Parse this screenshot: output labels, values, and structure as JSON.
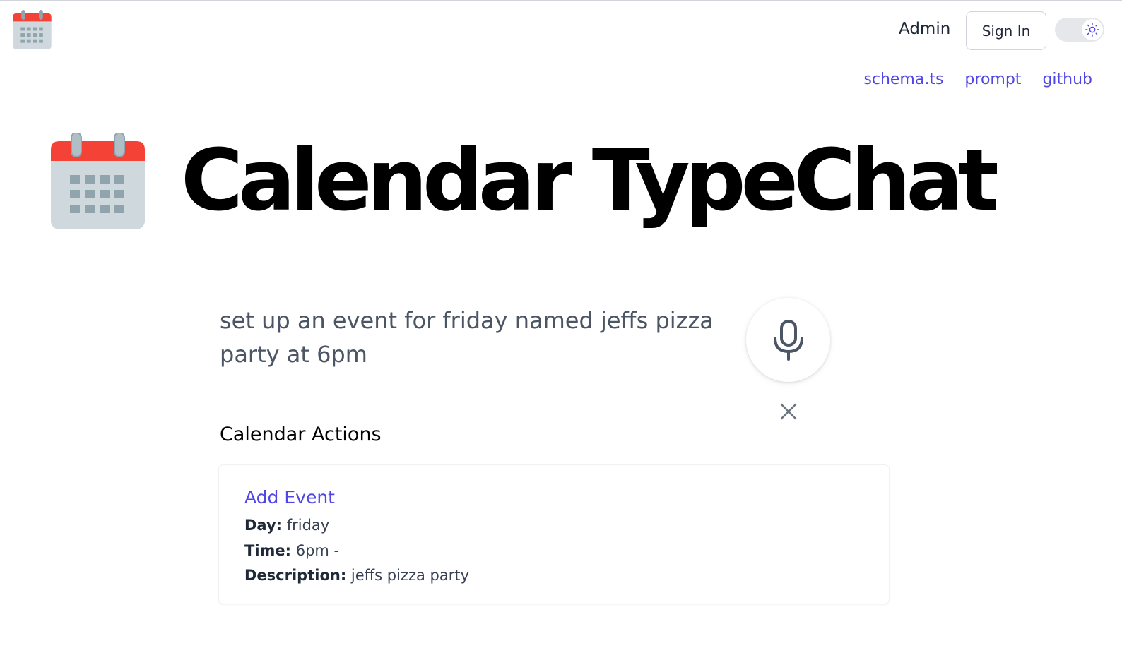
{
  "nav": {
    "logo_icon": "calendar-icon",
    "admin_label": "Admin",
    "signin_label": "Sign In",
    "theme_icon": "sun-icon"
  },
  "links": [
    "schema.ts",
    "prompt",
    "github"
  ],
  "hero": {
    "icon": "calendar-icon",
    "title": "Calendar TypeChat"
  },
  "input": {
    "prompt": "set up an event for friday named jeffs pizza party at 6pm",
    "mic_icon": "microphone-icon",
    "clear_icon": "close-icon"
  },
  "actions": {
    "heading": "Calendar Actions",
    "items": [
      {
        "title": "Add Event",
        "fields": [
          {
            "label": "Day:",
            "value": "friday"
          },
          {
            "label": "Time:",
            "value": "6pm -"
          },
          {
            "label": "Description:",
            "value": "jeffs pizza party"
          }
        ]
      }
    ]
  },
  "colors": {
    "accent": "#4f46e5",
    "calendar_red": "#f44336",
    "calendar_body": "#cfd8dc",
    "calendar_grid": "#90a4ae"
  }
}
